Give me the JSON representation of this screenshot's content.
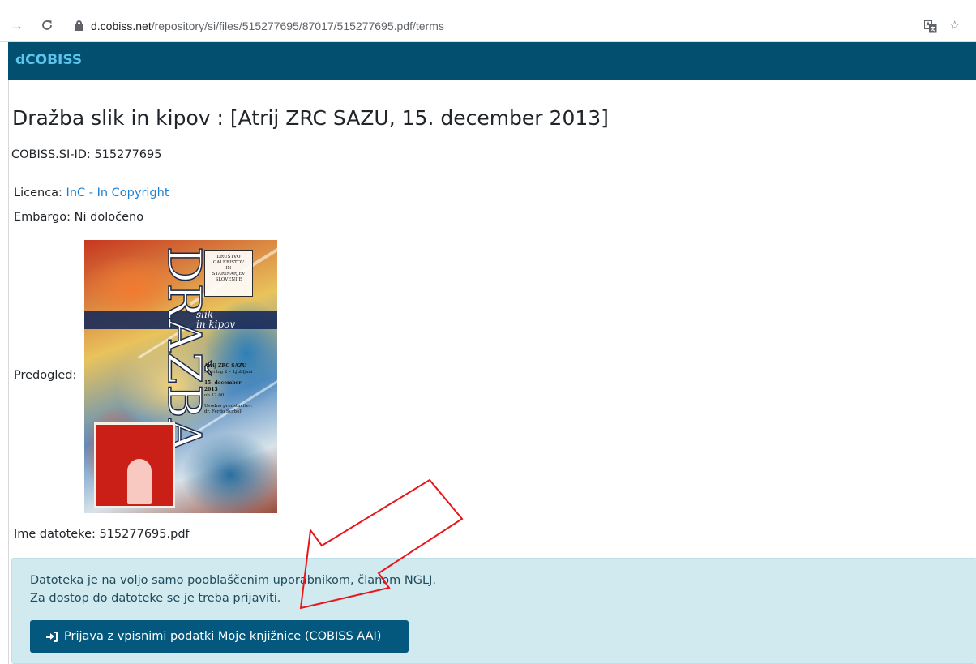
{
  "browser": {
    "url_host": "d.cobiss.net",
    "url_path": "/repository/si/files/515277695/87017/515277695.pdf/terms",
    "icons": [
      "forward-icon",
      "reload-icon",
      "lock-icon",
      "translate-icon",
      "star-icon"
    ]
  },
  "header": {
    "brand": "dCOBISS",
    "bar_color": "#034f6f",
    "brand_color": "#5dc4ee"
  },
  "record": {
    "title": "Dražba slik in kipov : [Atrij ZRC SAZU, 15. december 2013]",
    "cobiss_id_label": "COBISS.SI-ID:",
    "cobiss_id": "515277695",
    "licence_label": "Licenca:",
    "licence_link": "InC - In Copyright",
    "embargo_label": "Embargo:",
    "embargo_value": "Ni določeno",
    "preview_label": "Predogled:",
    "filename_label": "Ime datoteke:",
    "filename": "515277695.pdf"
  },
  "cover": {
    "big_title": "DRAŽBA",
    "subtitle_1": "slik",
    "subtitle_2": "in kipov",
    "org_lines": [
      "DRUŠTVO",
      "GALERISTOV",
      "IN",
      "STARINARJEV",
      "SLOVENIJE"
    ],
    "venue_title": "Atrij ZRC SAZU",
    "venue_address": "Novi trg 2 • Ljubljani",
    "date": "15. december 2013",
    "time": "ob 12.00",
    "host_label": "Uvodno predstavitev:",
    "host_name": "dr. Ferdo Šerbelj"
  },
  "alert": {
    "line_1": "Datoteka je na voljo samo pooblaščenim uporabnikom, članom NGLJ.",
    "line_2": "Za dostop do datoteke se je treba prijaviti.",
    "login_button": "Prijava z vpisnimi podatki Moje knjižnice (COBISS AAI)",
    "background": "#d0eaf0",
    "button_color": "#04587e"
  },
  "annotation": {
    "arrow_color": "#e8151b"
  }
}
